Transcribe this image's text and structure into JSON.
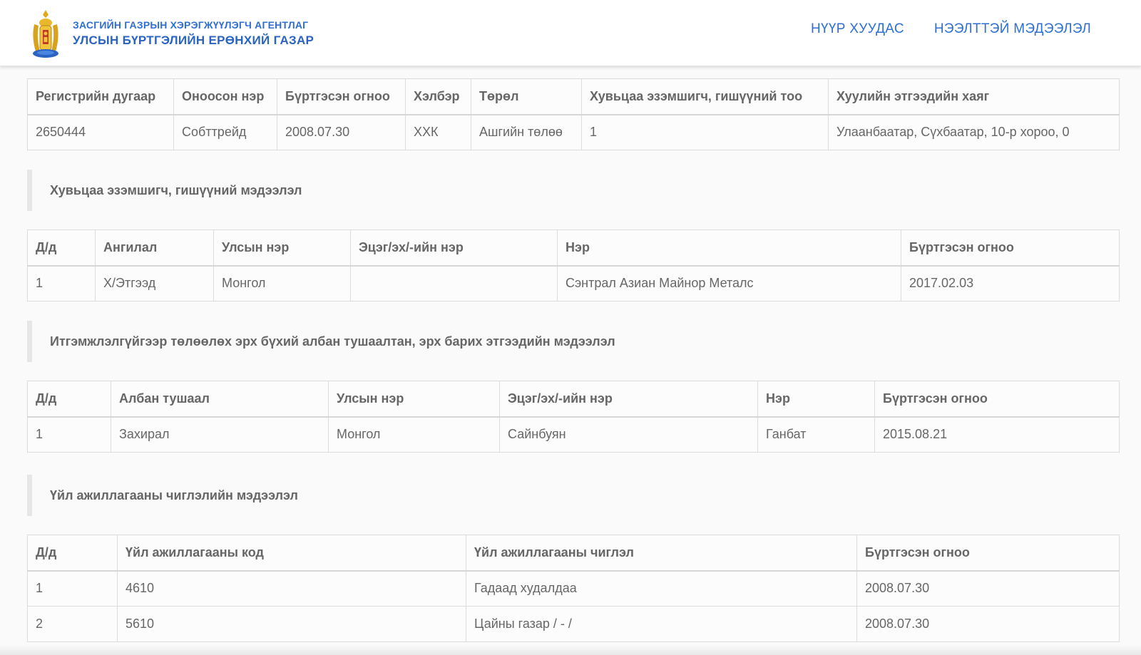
{
  "header": {
    "agency_line1": "ЗАСГИЙН ГАЗРЫН ХЭРЭГЖҮҮЛЭГЧ АГЕНТЛАГ",
    "agency_line2": "УЛСЫН БҮРТГЭЛИЙН ЕРӨНХИЙ ГАЗАР",
    "nav": [
      "НҮҮР ХУУДАС",
      "НЭЭЛТТЭЙ МЭДЭЭЛЭЛ"
    ]
  },
  "company": {
    "headers": [
      "Регистрийн дугаар",
      "Оноосон нэр",
      "Бүртгэсэн огноо",
      "Хэлбэр",
      "Төрөл",
      "Хувьцаа эзэмшигч, гишүүний тоо",
      "Хуулийн этгээдийн хаяг"
    ],
    "row": [
      "2650444",
      "Собттрейд",
      "2008.07.30",
      "ХХК",
      "Ашгийн төлөө",
      "1",
      "Улаанбаатар, Сүхбаатар, 10-р хороо, 0"
    ]
  },
  "shareholders": {
    "title": "Хувьцаа эзэмшигч, гишүүний мэдээлэл",
    "headers": [
      "Д/д",
      "Ангилал",
      "Улсын нэр",
      "Эцэг/эх/-ийн нэр",
      "Нэр",
      "Бүртгэсэн огноо"
    ],
    "rows": [
      [
        "1",
        "Х/Этгээд",
        "Монгол",
        "",
        "Сэнтрал Азиан Майнор Металс",
        "2017.02.03"
      ]
    ]
  },
  "officials": {
    "title": "Итгэмжлэлгүйгээр төлөөлөх эрх бүхий албан тушаалтан, эрх барих этгээдийн мэдээлэл",
    "headers": [
      "Д/д",
      "Албан тушаал",
      "Улсын нэр",
      "Эцэг/эх/-ийн нэр",
      "Нэр",
      "Бүртгэсэн огноо"
    ],
    "rows": [
      [
        "1",
        "Захирал",
        "Монгол",
        "Сайнбуян",
        "Ганбат",
        "2015.08.21"
      ]
    ]
  },
  "activities": {
    "title": "Үйл ажиллагааны чиглэлийн мэдээлэл",
    "headers": [
      "Д/д",
      "Үйл ажиллагааны код",
      "Үйл ажиллагааны чиглэл",
      "Бүртгэсэн огноо"
    ],
    "rows": [
      [
        "1",
        "4610",
        "Гадаад худалдаа",
        "2008.07.30"
      ],
      [
        "2",
        "5610",
        "Цайны газар / - /",
        "2008.07.30"
      ]
    ]
  }
}
